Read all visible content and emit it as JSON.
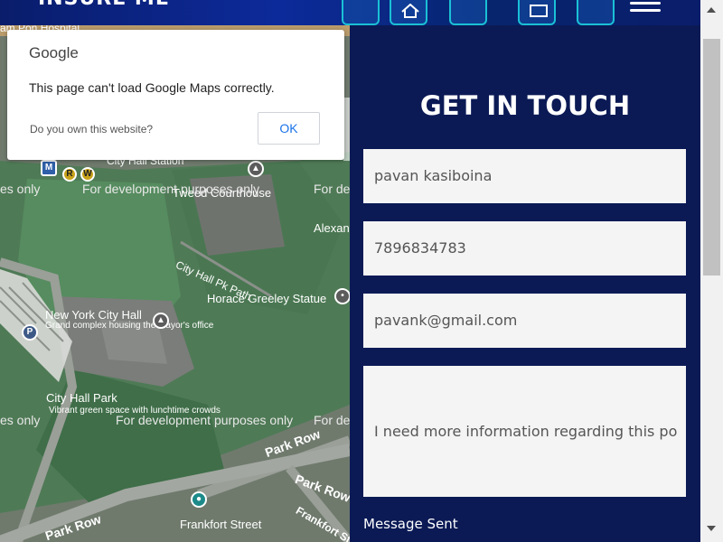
{
  "header": {
    "brand": "INSURE ME",
    "menu_icon": "hamburger-menu-icon"
  },
  "map": {
    "labels": {
      "top_partial": "am Pon Hospital",
      "city_hall_station": "City Hall Station",
      "tweed_courthouse": "Tweed Courthouse",
      "alexander": "Alexan",
      "city_hall_pk_path": "City Hall Pk Path",
      "horace_greeley": "Horace Greeley Statue",
      "nyc_hall": "New York City Hall",
      "nyc_hall_sub": "Grand complex housing the mayor's office",
      "city_hall_park": "City Hall Park",
      "city_hall_park_sub": "Vibrant green space with lunchtime crowds",
      "park_row_1": "Park Row",
      "park_row_2": "Park Row",
      "park_row_3": "Park Row",
      "frankfort_street": "Frankfort Street",
      "frankfort_st": "Frankfort St"
    },
    "dev_watermark": "For development purposes only",
    "dev_left": "es only",
    "dev_right": "For de"
  },
  "dialog": {
    "brand": "Google",
    "message": "This page can't load Google Maps correctly.",
    "own_link": "Do you own this website?",
    "ok_label": "OK"
  },
  "contact": {
    "title": "GET IN TOUCH",
    "name_value": "pavan kasiboina",
    "phone_value": "7896834783",
    "email_value": "pavank@gmail.com",
    "message_value": "I need more information regarding this po",
    "status": "Message Sent"
  },
  "colors": {
    "panel_bg": "#0b1a55",
    "field_bg": "#f4f4f4",
    "ok_text": "#1a73e8"
  }
}
